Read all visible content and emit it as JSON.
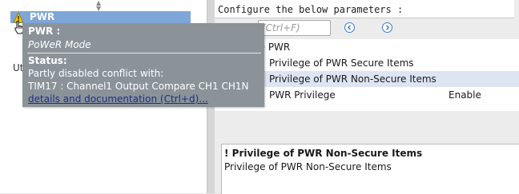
{
  "left_panel": {
    "selected_item": "PWR",
    "partial_label": "Ut"
  },
  "right_panel": {
    "header": "Configure the below parameters :",
    "search": {
      "placeholder": "(Ctrl+F)"
    },
    "parameters": {
      "group_label": "ge PWR",
      "rows": [
        {
          "name": "Privilege of PWR Secure Items",
          "value": ""
        },
        {
          "name": "Privilege of PWR Non-Secure Items",
          "value": ""
        },
        {
          "name": "PWR Privilege",
          "value": "Enable"
        }
      ]
    },
    "description": {
      "title": "! Privilege of PWR Non-Secure Items",
      "body": "Privilege of PWR Non-Secure Items"
    }
  },
  "tooltip": {
    "name": "PWR :",
    "description": "PoWeR Mode",
    "status_label": "Status:",
    "status_line1": "Partly disabled conflict with:",
    "status_line2": "TIM17 : Channel1 Output Compare CH1 CH1N",
    "link": "details and documentation (Ctrl+d)..."
  },
  "colors": {
    "selection": "#7ea6d8",
    "tooltip_bg": "#8b9399",
    "row_highlight": "#dde5f2",
    "link": "#1c2f87",
    "nav_accent": "#3d7ec7",
    "warning": "#f2c200"
  },
  "icons": {
    "warning": "warning-icon",
    "cursor": "hand-cursor-icon",
    "prev": "arrow-left-circle-icon",
    "next": "arrow-right-circle-icon",
    "scroll_up": "scroll-up-icon",
    "scroll_down": "scroll-down-icon"
  }
}
